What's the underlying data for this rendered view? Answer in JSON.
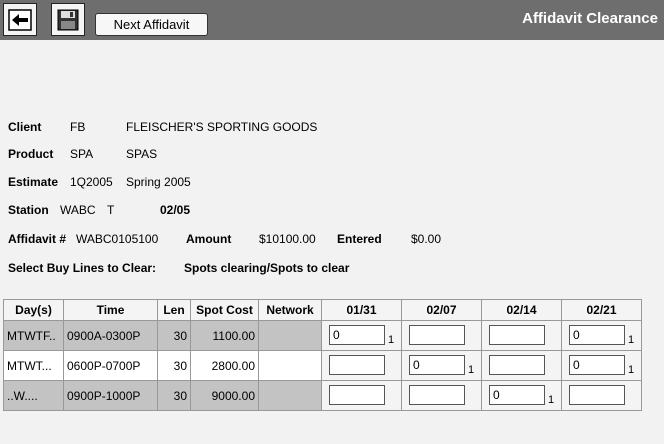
{
  "toolbar": {
    "back_icon": "back-arrow-icon",
    "save_icon": "save-disk-icon",
    "next_affidavit_label": "Next Affidavit",
    "screen_title": "Affidavit Clearance"
  },
  "info": {
    "client_label": "Client",
    "client_code": "FB",
    "client_name": "FLEISCHER'S SPORTING GOODS",
    "product_label": "Product",
    "product_code": "SPA",
    "product_name": "SPAS",
    "estimate_label": "Estimate",
    "estimate_code": "1Q2005",
    "estimate_name": "Spring 2005",
    "station_label": "Station",
    "station_code": "WABC",
    "station_media": "T",
    "station_period": "02/05",
    "affidavit_label": "Affidavit #",
    "affidavit_number": "WABC0105100",
    "amount_label": "Amount",
    "amount_value": "$10100.00",
    "entered_label": "Entered",
    "entered_value": "$0.00",
    "select_label": "Select Buy Lines to Clear:",
    "spots_label": "Spots clearing/Spots to clear"
  },
  "grid": {
    "headers": {
      "day": "Day(s)",
      "time": "Time",
      "len": "Len",
      "cost": "Spot Cost",
      "network": "Network"
    },
    "weeks": [
      "01/31",
      "02/07",
      "02/14",
      "02/21"
    ],
    "rows": [
      {
        "day": "MTWTF..",
        "time": "0900A-0300P",
        "len": "30",
        "cost": "1100.00",
        "network": "",
        "cells": [
          {
            "value": "0",
            "spots": "1"
          },
          {
            "value": "",
            "spots": ""
          },
          {
            "value": "",
            "spots": ""
          },
          {
            "value": "0",
            "spots": "1"
          }
        ]
      },
      {
        "day": "MTWT...",
        "time": "0600P-0700P",
        "len": "30",
        "cost": "2800.00",
        "network": "",
        "cells": [
          {
            "value": "",
            "spots": ""
          },
          {
            "value": "0",
            "spots": "1"
          },
          {
            "value": "",
            "spots": ""
          },
          {
            "value": "0",
            "spots": "1"
          }
        ]
      },
      {
        "day": "..W....",
        "time": "0900P-1000P",
        "len": "30",
        "cost": "9000.00",
        "network": "",
        "cells": [
          {
            "value": "",
            "spots": ""
          },
          {
            "value": "",
            "spots": ""
          },
          {
            "value": "0",
            "spots": "1"
          },
          {
            "value": "",
            "spots": ""
          }
        ]
      }
    ]
  }
}
